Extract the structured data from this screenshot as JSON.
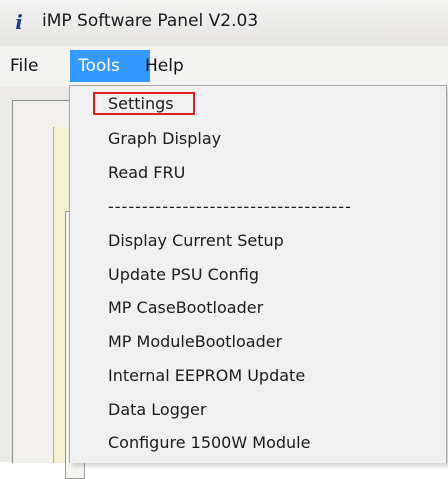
{
  "window": {
    "icon_glyph": "i",
    "title": "iMP Software Panel V2.03"
  },
  "menubar": {
    "items": [
      {
        "label": "File"
      },
      {
        "label": "Tools"
      },
      {
        "label": "Help"
      }
    ]
  },
  "tools_menu": {
    "items": [
      "Settings",
      "Graph Display",
      "Read FRU",
      "------------------------------------",
      "Display Current Setup",
      "Update PSU Config",
      "MP CaseBootloader",
      "MP ModuleBootloader",
      "Internal EEPROM Update",
      "Data Logger",
      "Configure 1500W Module"
    ]
  },
  "colors": {
    "menu_active_bg": "#3399ff",
    "annotation_box": "#e01f1f"
  },
  "icons": {
    "app": "app-info-icon"
  }
}
